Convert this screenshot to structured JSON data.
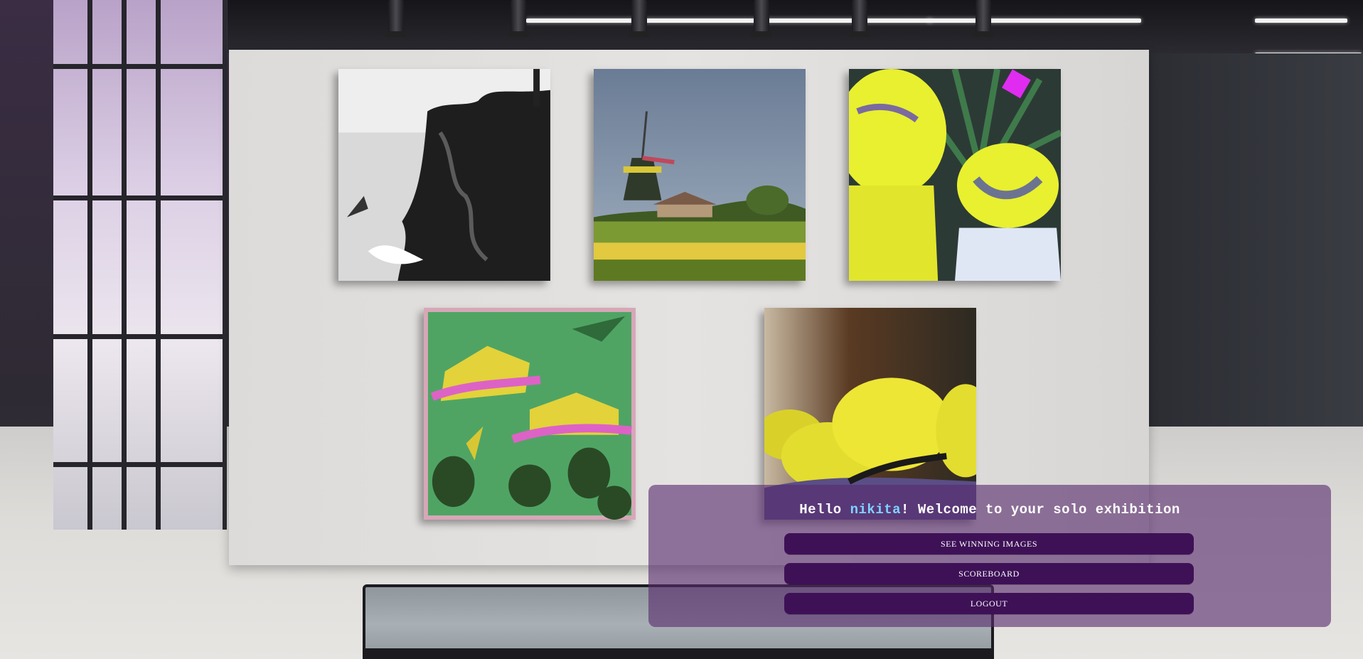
{
  "greeting": {
    "prefix": "Hello ",
    "username": "nikita",
    "suffix": "! Welcome to your solo exhibition"
  },
  "menu": {
    "see_winning_images": "SEE WINNING IMAGES",
    "scoreboard": "SCOREBOARD",
    "logout": "LOGOUT"
  },
  "colors": {
    "panel": "#582c6e",
    "button": "#3e1157",
    "username_accent": "#7fd3ff"
  }
}
